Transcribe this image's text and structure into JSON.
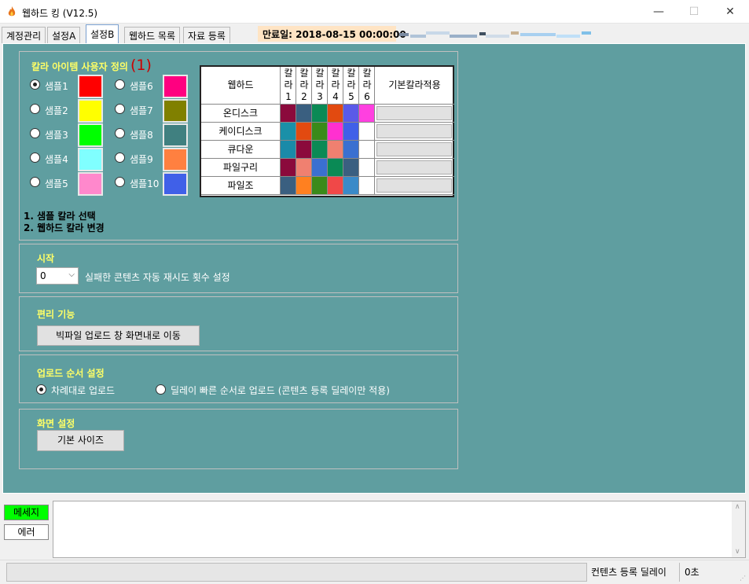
{
  "window": {
    "title": "웹하드 킹 (V12.5)",
    "min": "—",
    "max": "☐",
    "close": "✕"
  },
  "tabs": [
    "계정관리",
    "설정A",
    "설정B",
    "웹하드 목록",
    "자료 등록"
  ],
  "expiry": "만료일: 2018-08-15 00:00:00",
  "colorGroup": {
    "title": "칼라 아이템 사용자 정의",
    "marker": "(1)",
    "samples": [
      {
        "label": "샘플1",
        "color": "#ff0000",
        "selected": true
      },
      {
        "label": "샘플2",
        "color": "#ffff00",
        "selected": false
      },
      {
        "label": "샘플3",
        "color": "#00ff00",
        "selected": false
      },
      {
        "label": "샘플4",
        "color": "#80ffff",
        "selected": false
      },
      {
        "label": "샘플5",
        "color": "#ff88cc",
        "selected": false
      },
      {
        "label": "샘플6",
        "color": "#ff0080",
        "selected": false
      },
      {
        "label": "샘플7",
        "color": "#808000",
        "selected": false
      },
      {
        "label": "샘플8",
        "color": "#408080",
        "selected": false
      },
      {
        "label": "샘플9",
        "color": "#ff8040",
        "selected": false
      },
      {
        "label": "샘플10",
        "color": "#4060e8",
        "selected": false
      }
    ],
    "steps": [
      "1. 샘플 칼라 선택",
      "2. 웹하드 칼라 변경"
    ]
  },
  "colorTable": {
    "header": "웹하드",
    "colHeaders": [
      [
        "칼",
        "라",
        "1"
      ],
      [
        "칼",
        "라",
        "2"
      ],
      [
        "칼",
        "라",
        "3"
      ],
      [
        "칼",
        "라",
        "4"
      ],
      [
        "칼",
        "라",
        "5"
      ],
      [
        "칼",
        "라",
        "6"
      ]
    ],
    "applyHeader": "기본칼라적용",
    "rows": [
      {
        "name": "온디스크",
        "colors": [
          "#8b0a3c",
          "#3a5f80",
          "#0a8a55",
          "#e24a10",
          "#5a5ae8",
          "#ff40e0"
        ]
      },
      {
        "name": "케이디스크",
        "colors": [
          "#1a90a8",
          "#e24a10",
          "#3a8a1a",
          "#ff30d0",
          "#4060e8",
          "#ffffff"
        ]
      },
      {
        "name": "큐다운",
        "colors": [
          "#1a8aa8",
          "#8b0a3c",
          "#0a8a55",
          "#f08070",
          "#3a70d0",
          "#ffffff"
        ]
      },
      {
        "name": "파일구리",
        "colors": [
          "#8b0a3c",
          "#f08070",
          "#3a70d0",
          "#0a8a55",
          "#3a5f80",
          "#ffffff"
        ]
      },
      {
        "name": "파일조",
        "colors": [
          "#3a5f80",
          "#ff8020",
          "#3a8a1a",
          "#f04848",
          "#3a8ac8",
          "#ffffff"
        ]
      }
    ]
  },
  "startGroup": {
    "title": "시작",
    "comboValue": "0",
    "description": "실패한 콘텐츠 자동 재시도 횟수 설정"
  },
  "utilGroup": {
    "title": "편리 기능",
    "button": "빅파일 업로드 창 화면내로 이동"
  },
  "orderGroup": {
    "title": "업로드 순서 설정",
    "option1": "차례대로 업로드",
    "option2": "딜레이 빠른 순서로 업로드 (콘텐츠 등록 딜레이만 적용)",
    "selected": 1
  },
  "screenGroup": {
    "title": "화면 설정",
    "button": "기본 사이즈"
  },
  "messages": {
    "msgTab": "메세지",
    "errTab": "에러",
    "msgColor": "#00ff00"
  },
  "status": {
    "label": "컨텐츠 등록 딜레이",
    "value": "0초"
  }
}
